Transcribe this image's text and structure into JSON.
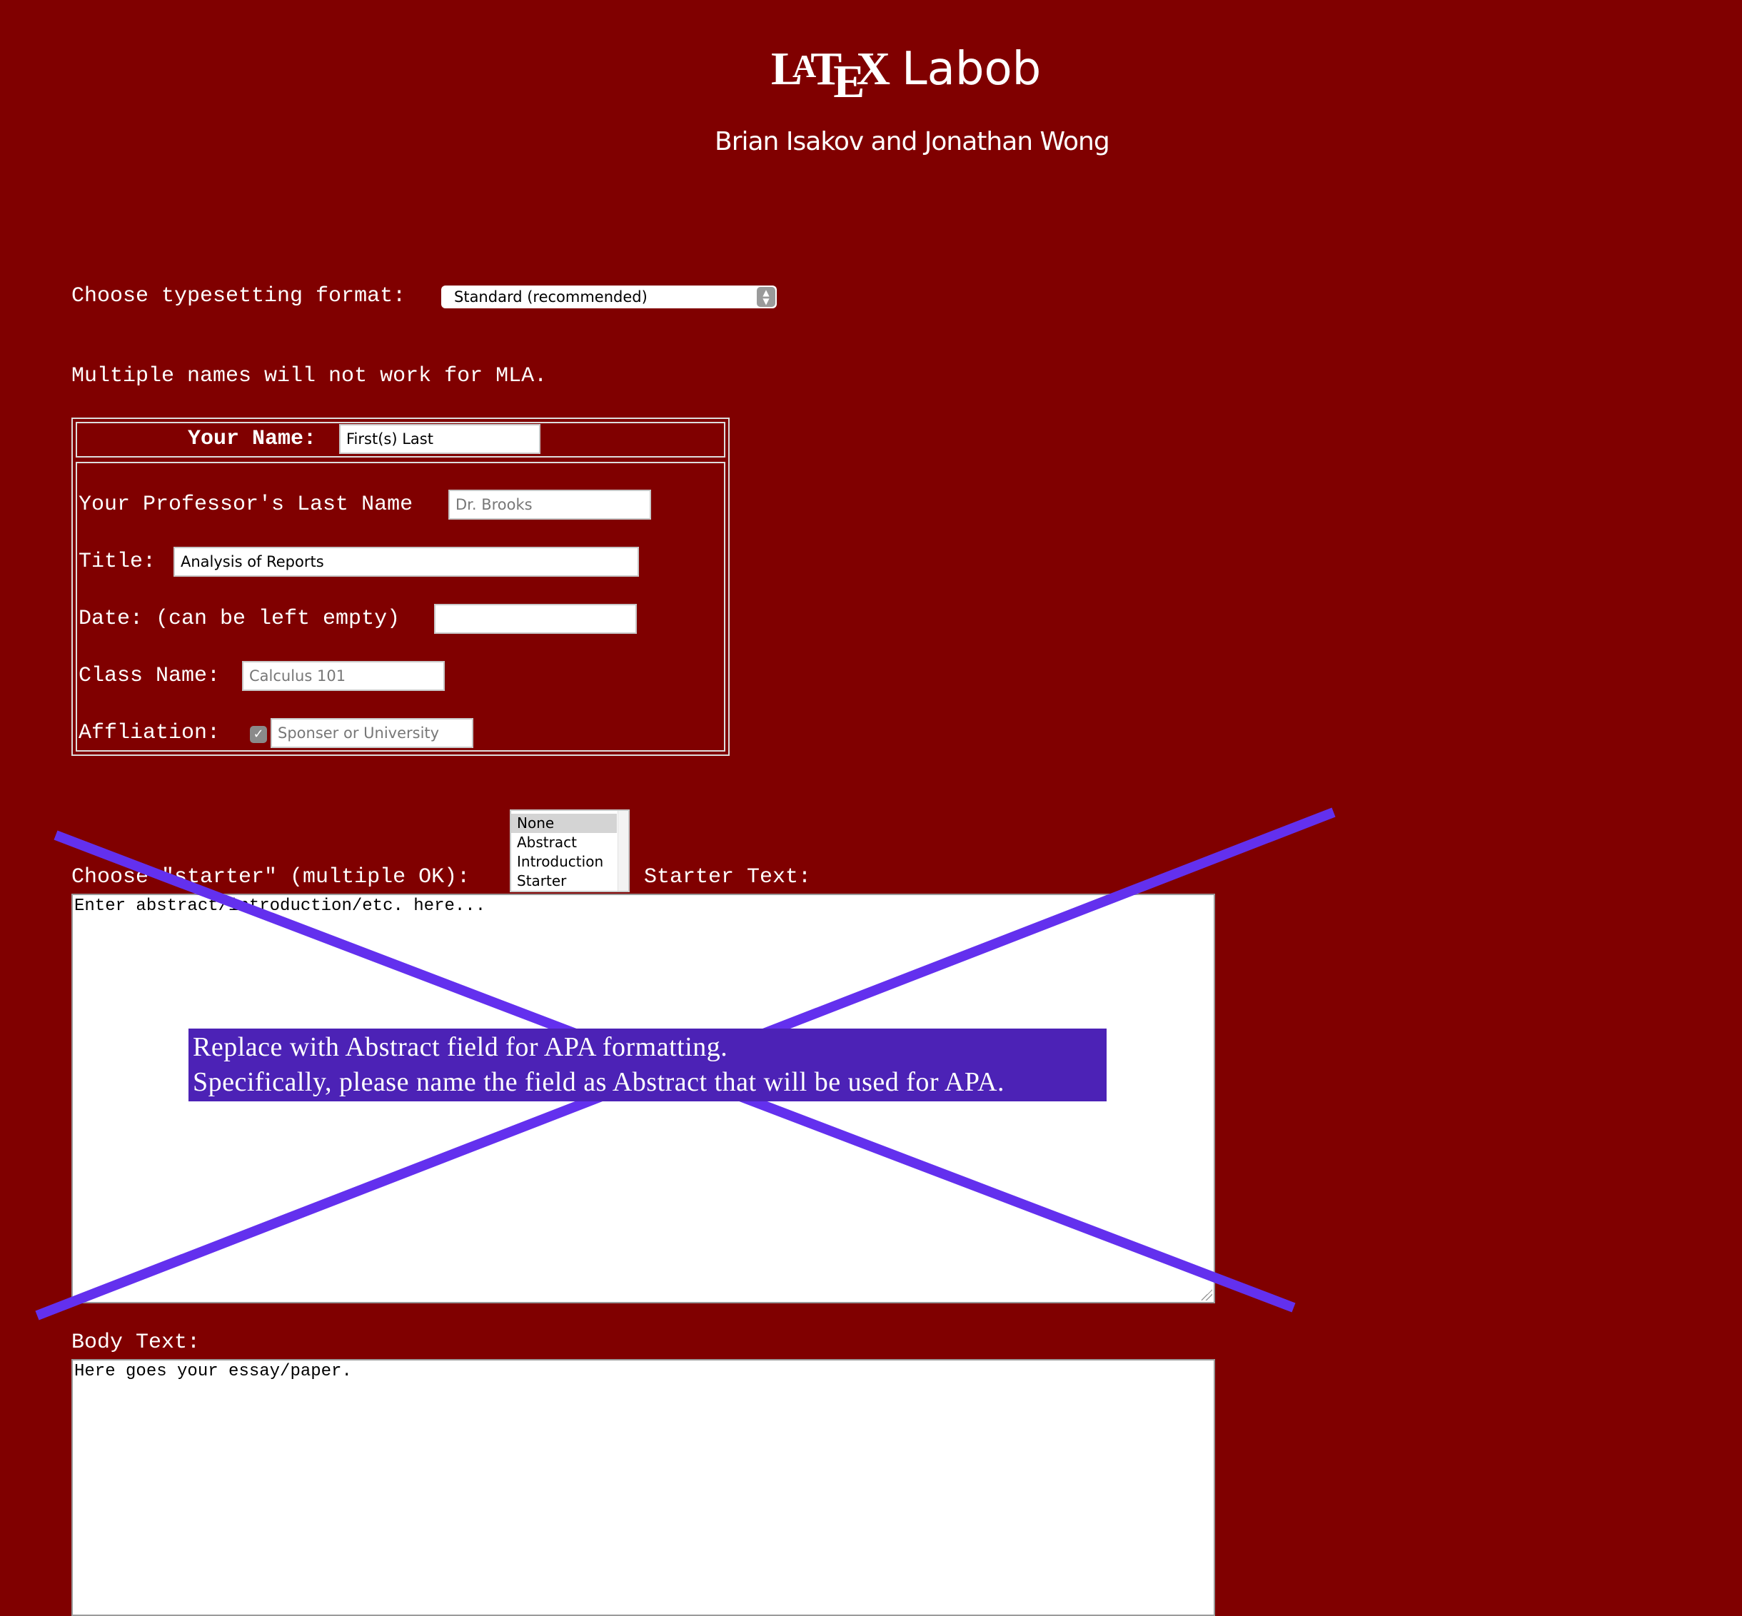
{
  "header": {
    "logo": {
      "la_l": "L",
      "la_a": "A",
      "la_t": "T",
      "la_e": "E",
      "la_x": "X",
      "name": "Labob"
    },
    "authors": "Brian Isakov and Jonathan Wong"
  },
  "format": {
    "label": "Choose typesetting format:",
    "selected": "Standard (recommended)"
  },
  "mla_note": "Multiple names will not work for MLA.",
  "form": {
    "name_label": "Your Name:",
    "name_value": "First(s) Last",
    "professor_label": "Your Professor's Last Name",
    "professor_placeholder": "Dr. Brooks",
    "title_label": "Title:",
    "title_value": "Analysis of Reports",
    "date_label": "Date: (can be left empty)",
    "date_value": "",
    "class_label": "Class Name:",
    "class_placeholder": "Calculus 101",
    "affiliation_label": "Affliation:",
    "affiliation_checked": true,
    "affiliation_placeholder": "Sponser or University"
  },
  "starter": {
    "label": "Choose \"starter\" (multiple OK):",
    "options": [
      "None",
      "Abstract",
      "Introduction",
      "Starter"
    ],
    "selected": "None",
    "text_label": "Starter Text:",
    "text_placeholder": "Enter abstract/introduction/etc. here..."
  },
  "body": {
    "label": "Body Text:",
    "placeholder": "Here goes your essay/paper."
  },
  "annotation": {
    "line1": "Replace with Abstract field for APA formatting.",
    "line2": "Specifically, please name the field as Abstract that will be used for APA.",
    "cross_color": "#6330ee",
    "box_color": "#4c22b6"
  },
  "colors": {
    "background": "#800000"
  }
}
